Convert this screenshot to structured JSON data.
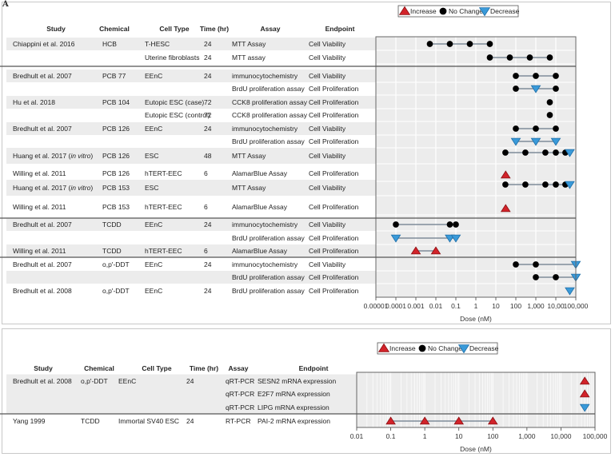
{
  "panel_label": "A",
  "colors": {
    "increase": "#d2232a",
    "increase_stroke": "#8b1014",
    "decrease": "#3a9ad9",
    "decrease_stroke": "#1f6fa8",
    "nochange": "#000000",
    "connector": "#7f8c99",
    "row_shade": "#ececec",
    "plot_bg": "#ececec"
  },
  "legend": [
    {
      "label": "Increase",
      "marker": "triangle-up-red-icon"
    },
    {
      "label": "No Change",
      "marker": "circle-black-icon"
    },
    {
      "label": "Decrease",
      "marker": "triangle-down-blue-icon"
    }
  ],
  "chart_data": [
    {
      "type": "scatter",
      "title": "",
      "xlabel": "Dose (nM)",
      "xscale": "log",
      "xlim": [
        1e-05,
        100000
      ],
      "xticks": [
        1e-05,
        0.0001,
        0.001,
        0.01,
        0.1,
        1,
        10,
        100,
        1000,
        10000,
        100000
      ],
      "xtick_labels": [
        "0.00001",
        "0.0001",
        "0.001",
        "0.01",
        "0.1",
        "1",
        "10",
        "100",
        "1,000",
        "10,00",
        "100,000"
      ],
      "grid": true,
      "legend_position": "top",
      "columns": [
        "Study",
        "Chemical",
        "Cell Type",
        "Time (hr)",
        "Assay",
        "Endpoint"
      ],
      "groups": [
        {
          "rows": [
            {
              "study": "Chiappini et al. 2016",
              "chemical": "HCB",
              "cell_type": "T-HESC",
              "time": "24",
              "assay": "MTT Assay",
              "endpoint": "Cell Viability",
              "shade": true,
              "points": [
                {
                  "dose": 0.005,
                  "effect": "nochange"
                },
                {
                  "dose": 0.05,
                  "effect": "nochange"
                },
                {
                  "dose": 0.5,
                  "effect": "nochange"
                },
                {
                  "dose": 5,
                  "effect": "nochange"
                }
              ]
            },
            {
              "study": "",
              "chemical": "",
              "cell_type": "Uterine fibroblasts",
              "time": "24",
              "assay": "MTT assay",
              "endpoint": "Cell Viability",
              "shade": false,
              "points": [
                {
                  "dose": 5,
                  "effect": "nochange"
                },
                {
                  "dose": 50,
                  "effect": "nochange"
                },
                {
                  "dose": 500,
                  "effect": "nochange"
                },
                {
                  "dose": 5000,
                  "effect": "nochange"
                }
              ]
            }
          ]
        },
        {
          "rows": [
            {
              "study": "Bredhult et al. 2007",
              "chemical": "PCB 77",
              "cell_type": "EEnC",
              "time": "24",
              "assay": "immunocytochemistry",
              "endpoint": "Cell Viability",
              "shade": true,
              "points": [
                {
                  "dose": 100,
                  "effect": "nochange"
                },
                {
                  "dose": 1000,
                  "effect": "nochange"
                },
                {
                  "dose": 10000,
                  "effect": "nochange"
                }
              ]
            },
            {
              "study": "",
              "chemical": "",
              "cell_type": "",
              "time": "",
              "assay": "BrdU proliferation assay",
              "endpoint": "Cell Proliferation",
              "shade": false,
              "points": [
                {
                  "dose": 100,
                  "effect": "nochange"
                },
                {
                  "dose": 1000,
                  "effect": "decrease"
                },
                {
                  "dose": 10000,
                  "effect": "nochange"
                }
              ]
            },
            {
              "study": "Hu et al. 2018",
              "chemical": "PCB 104",
              "cell_type": "Eutopic ESC (case)",
              "time": "72",
              "assay": "CCK8 proliferation assay",
              "endpoint": "Cell Proliferation",
              "shade": true,
              "points": [
                {
                  "dose": 5000,
                  "effect": "nochange"
                }
              ]
            },
            {
              "study": "",
              "chemical": "",
              "cell_type": "Eutopic ESC (control)",
              "time": "72",
              "assay": "CCK8 proliferation assay",
              "endpoint": "Cell Proliferation",
              "shade": false,
              "points": [
                {
                  "dose": 5000,
                  "effect": "nochange"
                }
              ]
            },
            {
              "study": "Bredhult et al. 2007",
              "chemical": "PCB 126",
              "cell_type": "EEnC",
              "time": "24",
              "assay": "immunocytochemistry",
              "endpoint": "Cell Viability",
              "shade": true,
              "points": [
                {
                  "dose": 100,
                  "effect": "nochange"
                },
                {
                  "dose": 1000,
                  "effect": "nochange"
                },
                {
                  "dose": 10000,
                  "effect": "nochange"
                }
              ]
            },
            {
              "study": "",
              "chemical": "",
              "cell_type": "",
              "time": "",
              "assay": "BrdU proliferation assay",
              "endpoint": "Cell Proliferation",
              "shade": false,
              "points": [
                {
                  "dose": 100,
                  "effect": "decrease"
                },
                {
                  "dose": 1000,
                  "effect": "decrease"
                },
                {
                  "dose": 10000,
                  "effect": "decrease"
                }
              ]
            },
            {
              "study": "Huang et al. 2017 (in vitro)",
              "study_main": "Huang et al. 2017 (",
              "study_italic": "in vitro",
              "study_end": ")",
              "chemical": "PCB 126",
              "cell_type": "ESC",
              "time": "48",
              "assay": "MTT Assay",
              "endpoint": "Cell Viability",
              "shade": true,
              "tall": true,
              "points": [
                {
                  "dose": 30,
                  "effect": "nochange"
                },
                {
                  "dose": 300,
                  "effect": "nochange"
                },
                {
                  "dose": 3000,
                  "effect": "nochange"
                },
                {
                  "dose": 10000,
                  "effect": "nochange"
                },
                {
                  "dose": 30000,
                  "effect": "nochange"
                },
                {
                  "dose": 50000,
                  "effect": "decrease"
                }
              ]
            },
            {
              "study": "Willing et al. 2011",
              "chemical": "PCB 126",
              "cell_type": "hTERT-EEC",
              "time": "6",
              "assay": "AlamarBlue Assay",
              "endpoint": "Cell Proliferation",
              "shade": false,
              "points": [
                {
                  "dose": 31,
                  "effect": "increase"
                }
              ]
            },
            {
              "study": "Huang et al. 2017 (in vitro)",
              "study_main": "Huang et al. 2017 (",
              "study_italic": "in vitro",
              "study_end": ")",
              "chemical": "PCB 153",
              "cell_type": "ESC",
              "time": "",
              "assay": "MTT Assay",
              "endpoint": "Cell Viability",
              "shade": true,
              "tall": true,
              "points": [
                {
                  "dose": 30,
                  "effect": "nochange"
                },
                {
                  "dose": 300,
                  "effect": "nochange"
                },
                {
                  "dose": 3000,
                  "effect": "nochange"
                },
                {
                  "dose": 10000,
                  "effect": "nochange"
                },
                {
                  "dose": 30000,
                  "effect": "nochange"
                },
                {
                  "dose": 50000,
                  "effect": "decrease"
                }
              ]
            },
            {
              "study": "Willing et al. 2011",
              "chemical": "PCB 153",
              "cell_type": "hTERT-EEC",
              "time": "6",
              "assay": "AlamarBlue Assay",
              "endpoint": "Cell Proliferation",
              "shade": false,
              "points": [
                {
                  "dose": 31,
                  "effect": "increase"
                }
              ]
            }
          ]
        },
        {
          "rows": [
            {
              "study": "Bredhult et al. 2007",
              "chemical": "TCDD",
              "cell_type": "EEnC",
              "time": "24",
              "assay": "immunocytochemistry",
              "endpoint": "Cell Viability",
              "shade": true,
              "points": [
                {
                  "dose": 0.0001,
                  "effect": "nochange"
                },
                {
                  "dose": 0.05,
                  "effect": "nochange"
                },
                {
                  "dose": 0.1,
                  "effect": "nochange"
                }
              ]
            },
            {
              "study": "",
              "chemical": "",
              "cell_type": "",
              "time": "",
              "assay": "BrdU proliferation assay",
              "endpoint": "Cell Proliferation",
              "shade": false,
              "points": [
                {
                  "dose": 0.0001,
                  "effect": "decrease"
                },
                {
                  "dose": 0.05,
                  "effect": "decrease"
                },
                {
                  "dose": 0.1,
                  "effect": "decrease"
                }
              ]
            },
            {
              "study": "Willing et al. 2011",
              "chemical": "TCDD",
              "cell_type": "hTERT-EEC",
              "time": "6",
              "assay": "AlamarBlue Assay",
              "endpoint": "Cell Proliferation",
              "shade": true,
              "points": [
                {
                  "dose": 0.001,
                  "effect": "increase"
                },
                {
                  "dose": 0.01,
                  "effect": "increase"
                }
              ]
            }
          ]
        },
        {
          "rows": [
            {
              "study": "Bredhult et al. 2007",
              "chemical": "o,p'-DDT",
              "cell_type": "EEnC",
              "time": "24",
              "assay": "immunocytochemistry",
              "endpoint": "Cell Viability",
              "shade": false,
              "points": [
                {
                  "dose": 100,
                  "effect": "nochange"
                },
                {
                  "dose": 1000,
                  "effect": "nochange"
                },
                {
                  "dose": 100000,
                  "effect": "decrease"
                }
              ]
            },
            {
              "study": "",
              "chemical": "",
              "cell_type": "",
              "time": "",
              "assay": "BrdU proliferation assay",
              "endpoint": "Cell Proliferation",
              "shade": true,
              "points": [
                {
                  "dose": 1000,
                  "effect": "nochange"
                },
                {
                  "dose": 10000,
                  "effect": "nochange"
                },
                {
                  "dose": 100000,
                  "effect": "decrease"
                }
              ]
            },
            {
              "study": "Bredhult et al. 2008",
              "chemical": "o,p'-DDT",
              "cell_type": "EEnC",
              "time": "24",
              "assay": "BrdU proliferation assay",
              "endpoint": "Cell Proliferation",
              "shade": false,
              "points": [
                {
                  "dose": 50000,
                  "effect": "decrease"
                }
              ]
            }
          ]
        }
      ]
    },
    {
      "type": "scatter",
      "title": "",
      "xlabel": "Dose (nM)",
      "xscale": "log",
      "xlim": [
        0.01,
        100000
      ],
      "xticks": [
        0.01,
        0.1,
        1,
        10,
        100,
        1000,
        10000,
        100000
      ],
      "xtick_labels": [
        "0.01",
        "0.1",
        "1",
        "10",
        "100",
        "1,000",
        "10,000",
        "100,000"
      ],
      "grid": true,
      "legend_position": "top",
      "columns": [
        "Study",
        "Chemical",
        "Cell Type",
        "Time (hr)",
        "Assay",
        "Endpoint"
      ],
      "groups": [
        {
          "rows": [
            {
              "study": "Bredhult et al. 2008",
              "chemical": "o,p'-DDT",
              "cell_type": "EEnC",
              "time": "24",
              "assay": "qRT-PCR",
              "endpoint": "SESN2 mRNA expression",
              "points": [
                {
                  "dose": 50000,
                  "effect": "increase"
                }
              ]
            },
            {
              "study": "",
              "chemical": "",
              "cell_type": "",
              "time": "",
              "assay": "qRT-PCR",
              "endpoint": "E2F7 mRNA expression",
              "points": [
                {
                  "dose": 50000,
                  "effect": "increase"
                }
              ]
            },
            {
              "study": "",
              "chemical": "",
              "cell_type": "",
              "time": "",
              "assay": "qRT-PCR",
              "endpoint": "LIPG mRNA expression",
              "points": [
                {
                  "dose": 50000,
                  "effect": "decrease"
                }
              ]
            }
          ]
        },
        {
          "rows": [
            {
              "study": "Yang 1999",
              "chemical": "TCDD",
              "cell_type": "Immortal SV40 ESC",
              "time": "24",
              "assay": "RT-PCR",
              "endpoint": "PAI-2 mRNA expression",
              "points": [
                {
                  "dose": 0.1,
                  "effect": "increase"
                },
                {
                  "dose": 1,
                  "effect": "increase"
                },
                {
                  "dose": 10,
                  "effect": "increase"
                },
                {
                  "dose": 100,
                  "effect": "increase"
                }
              ]
            }
          ]
        }
      ]
    }
  ]
}
